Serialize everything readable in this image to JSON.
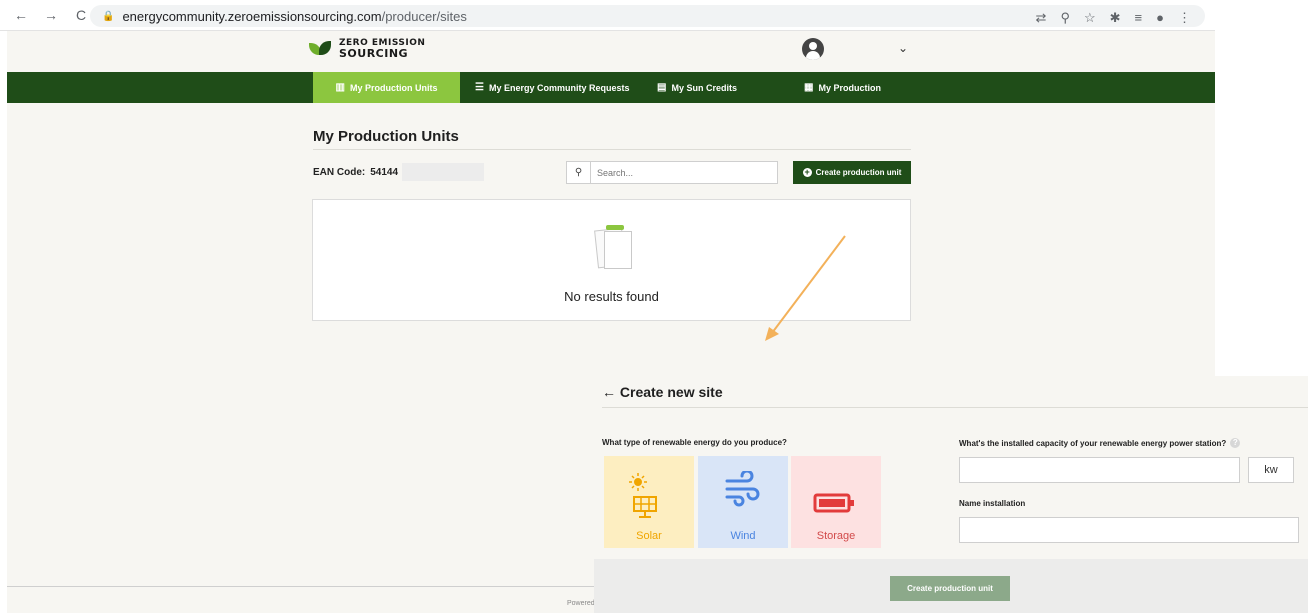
{
  "browser": {
    "url_host": "energycommunity.zeroemissionsourcing.com",
    "url_path": "/producer/sites",
    "nav": {
      "back": "←",
      "forward": "→",
      "reload": "C"
    },
    "icons": [
      "translate-icon",
      "zoom-icon",
      "star-icon",
      "extensions-icon",
      "reading-list-icon",
      "profile-icon",
      "menu-icon"
    ]
  },
  "header": {
    "logo_line1": "ZERO EMISSION",
    "logo_line2": "SOURCING",
    "user_chevron": "⌄"
  },
  "navbar": {
    "items": [
      {
        "label": "My Production Units",
        "icon": "building-icon",
        "active": true
      },
      {
        "label": "My Energy Community Requests",
        "icon": "list-icon",
        "active": false
      },
      {
        "label": "My Sun Credits",
        "icon": "document-icon",
        "active": false
      },
      {
        "label": "My Production",
        "icon": "chart-icon",
        "active": false
      }
    ],
    "colors": {
      "bar": "#1f4d18",
      "active": "#8cc63f"
    }
  },
  "main": {
    "title": "My Production Units",
    "ean_label": "EAN Code:",
    "ean_value": "54144",
    "search_placeholder": "Search...",
    "create_button": "Create production unit",
    "empty_text": "No results found",
    "footer_text": "Powered by"
  },
  "create_site": {
    "title": "Create new site",
    "back_glyph": "←",
    "question_type": "What type of renewable energy do you produce?",
    "question_capacity": "What's the installed capacity of your renewable energy power station?",
    "help_glyph": "?",
    "tiles": [
      {
        "label": "Solar",
        "icon": "solar-panel-icon",
        "color": "#f0a500"
      },
      {
        "label": "Wind",
        "icon": "wind-icon",
        "color": "#4a84e0"
      },
      {
        "label": "Storage",
        "icon": "battery-icon",
        "color": "#d24a4a"
      }
    ],
    "capacity_unit": "kw",
    "name_label": "Name installation",
    "submit_button": "Create production unit"
  }
}
